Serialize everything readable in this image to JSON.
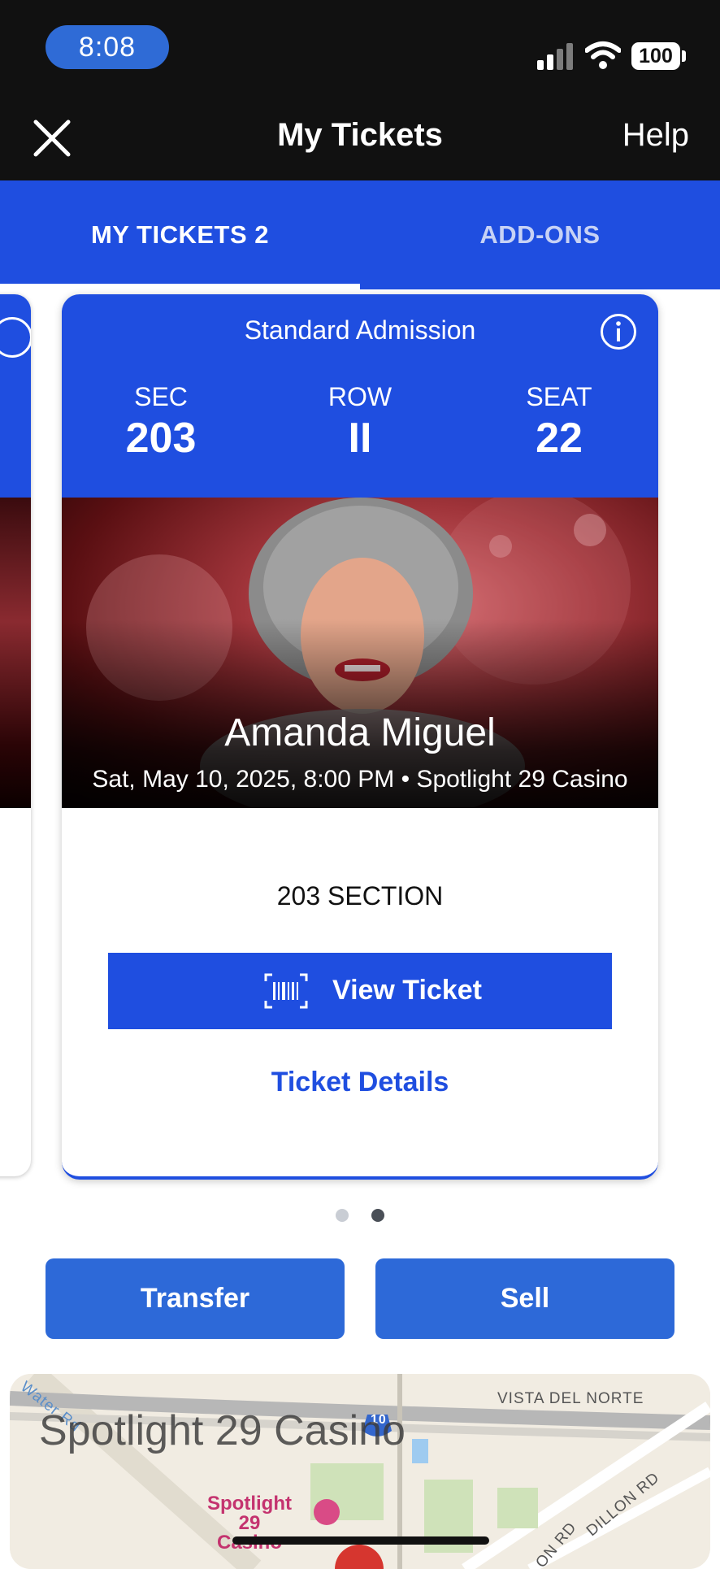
{
  "status_bar": {
    "time": "8:08",
    "battery": "100"
  },
  "nav": {
    "title": "My Tickets",
    "help": "Help"
  },
  "tabs": [
    {
      "label": "MY TICKETS 2",
      "active": true
    },
    {
      "label": "ADD-ONS",
      "active": false
    }
  ],
  "ticket": {
    "admission": "Standard Admission",
    "sec_label": "SEC",
    "sec": "203",
    "row_label": "ROW",
    "row": "II",
    "seat_label": "SEAT",
    "seat": "22",
    "performer": "Amanda Miguel",
    "event_line": "Sat, May 10, 2025, 8:00 PM • Spotlight 29 Casino",
    "section": "203 SECTION",
    "view_ticket": "View Ticket",
    "ticket_details": "Ticket Details"
  },
  "pager": {
    "count": 2,
    "active": 2
  },
  "actions": {
    "transfer": "Transfer",
    "sell": "Sell"
  },
  "map": {
    "venue": "Spotlight 29 Casino",
    "streets": [
      "Vista Del Norte",
      "Dillon Rd",
      "ON RD",
      "Water Rd"
    ],
    "poi": "Spotlight 29 Casino",
    "highway": "10"
  },
  "colors": {
    "brand": "#1f4ee0",
    "action": "#2d69d8",
    "dark": "#111111"
  }
}
